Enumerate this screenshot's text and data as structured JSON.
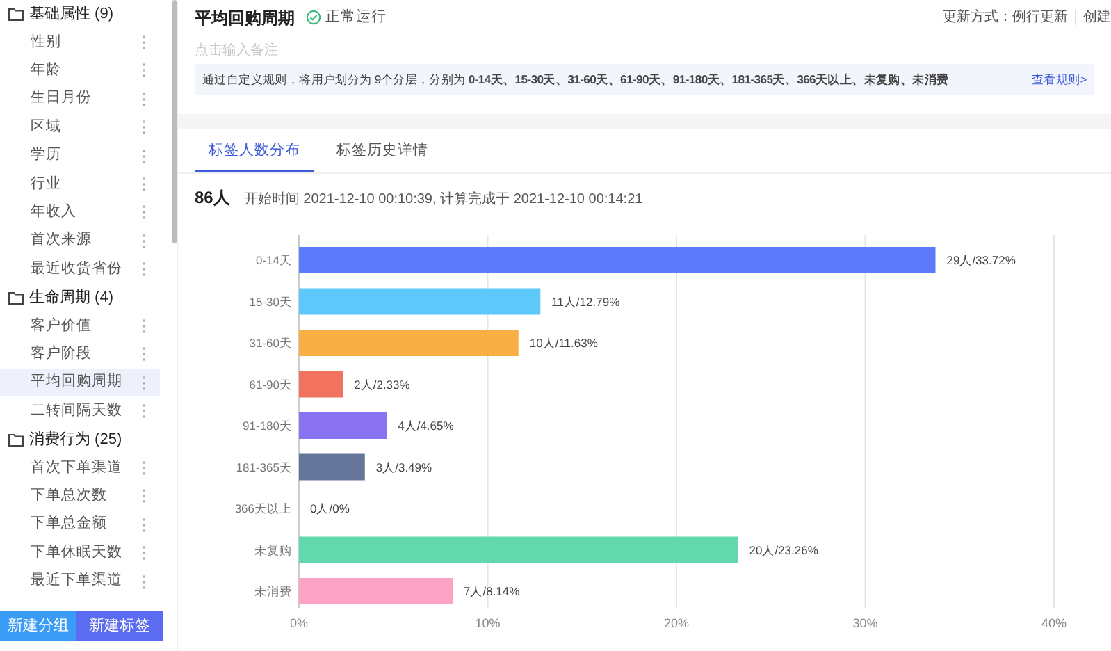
{
  "sidebar": {
    "groups": [
      {
        "label": "基础属性 (9)",
        "items": [
          {
            "label": "性别",
            "selected": false
          },
          {
            "label": "年龄",
            "selected": false
          },
          {
            "label": "生日月份",
            "selected": false
          },
          {
            "label": "区域",
            "selected": false
          },
          {
            "label": "学历",
            "selected": false
          },
          {
            "label": "行业",
            "selected": false
          },
          {
            "label": "年收入",
            "selected": false
          },
          {
            "label": "首次来源",
            "selected": false
          },
          {
            "label": "最近收货省份",
            "selected": false
          }
        ]
      },
      {
        "label": "生命周期 (4)",
        "items": [
          {
            "label": "客户价值",
            "selected": false
          },
          {
            "label": "客户阶段",
            "selected": false
          },
          {
            "label": "平均回购周期",
            "selected": true
          },
          {
            "label": "二转间隔天数",
            "selected": false
          }
        ]
      },
      {
        "label": "消费行为 (25)",
        "items": [
          {
            "label": "首次下单渠道",
            "selected": false
          },
          {
            "label": "下单总次数",
            "selected": false
          },
          {
            "label": "下单总金额",
            "selected": false
          },
          {
            "label": "下单休眠天数",
            "selected": false
          },
          {
            "label": "最近下单渠道",
            "selected": false
          }
        ]
      }
    ],
    "buttons": [
      {
        "label": "新建分组",
        "kind": "secondary"
      },
      {
        "label": "新建标签",
        "kind": "primary"
      }
    ]
  },
  "header": {
    "title": "平均回购周期",
    "status": "正常运行",
    "update": "更新方式：例行更新",
    "creator": "创建",
    "note_placeholder": "点击输入备注",
    "banner": {
      "text": "通过自定义规则，将用户划分为 9个分层，分别为 **0-14天、15-30天、31-60天、61-90天、91-180天、181-365天、366天以上、未复购、未消费**",
      "link": "查看规则>"
    }
  },
  "tabs": [
    {
      "label": "标签人数分布",
      "selected": true
    },
    {
      "label": "标签历史详情",
      "selected": false
    }
  ],
  "summary": {
    "count": "86人",
    "detail": "开始时间 2021-12-10 00:10:39, 计算完成于 2021-12-10 00:14:21"
  },
  "chart_data": {
    "type": "bar",
    "orientation": "horizontal",
    "categories": [
      "0-14天",
      "15-30天",
      "31-60天",
      "61-90天",
      "91-180天",
      "181-365天",
      "366天以上",
      "未复购",
      "未消费"
    ],
    "values": [
      33.72,
      12.79,
      11.63,
      2.33,
      4.65,
      3.49,
      0,
      23.26,
      8.14
    ],
    "colors": [
      "#5b7bfb",
      "#5ec8fb",
      "#f8b045",
      "#f27260",
      "#8a73f0",
      "#65769a",
      null,
      "#63d7ad",
      "#fda3c5"
    ],
    "value_labels": [
      "29人/33.72%",
      "11人/12.79%",
      "10人/11.63%",
      "2人/2.33%",
      "4人/4.65%",
      "3人/3.49%",
      "0人/0%",
      "20人/23.26%",
      "7人/8.14%"
    ],
    "xlim": [
      0,
      40
    ],
    "grid": true,
    "xticks": [
      {
        "value": 0,
        "label": "0%"
      },
      {
        "value": 10,
        "label": "10%"
      },
      {
        "value": 20,
        "label": "20%"
      },
      {
        "value": 30,
        "label": "30%"
      },
      {
        "value": 40,
        "label": "40%"
      }
    ]
  }
}
